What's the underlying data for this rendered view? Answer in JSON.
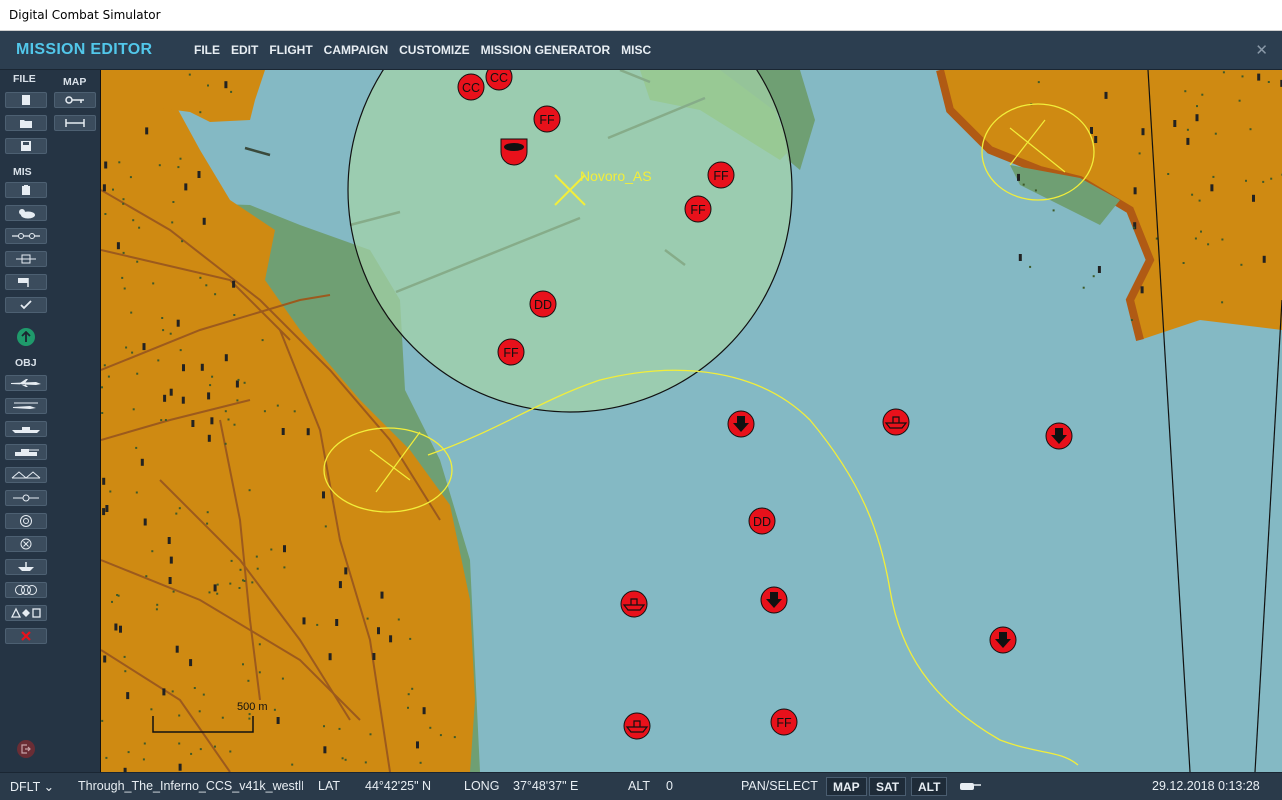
{
  "window": {
    "title": "Digital Combat Simulator"
  },
  "menubar": {
    "brand": "MISSION EDITOR",
    "items": [
      "FILE",
      "EDIT",
      "FLIGHT",
      "CAMPAIGN",
      "CUSTOMIZE",
      "MISSION GENERATOR",
      "MISC"
    ],
    "close": "✕"
  },
  "sidebar": {
    "file_label": "FILE",
    "map_label": "MAP",
    "mis_label": "MIS",
    "obj_label": "OBJ"
  },
  "map": {
    "zone_label": "Novoro_AS",
    "scale_label": "500 m",
    "colors": {
      "sea": "#84b9c4",
      "land": "#cf8a12",
      "lowland": "#6f9f73",
      "zone": "#a3d2a8",
      "enemy": "#e8111b",
      "route": "#f2ee3a"
    },
    "units_top": [
      "CC",
      "CC",
      "FF"
    ],
    "units_mid": [
      "FF",
      "FF",
      "DD",
      "FF"
    ],
    "units_low": [
      "DD",
      "FF"
    ]
  },
  "statusbar": {
    "profile": "DFLT",
    "mission": "Through_The_Inferno_CCS_v41k_westlI",
    "lat_label": "LAT",
    "lat_value": "44°42'25\" N",
    "long_label": "LONG",
    "long_value": "37°48'37\" E",
    "alt_label": "ALT",
    "alt_value": "0",
    "mode": "PAN/SELECT",
    "btn_map": "MAP",
    "btn_sat": "SAT",
    "btn_alt": "ALT",
    "datetime": "29.12.2018 0:13:28"
  }
}
